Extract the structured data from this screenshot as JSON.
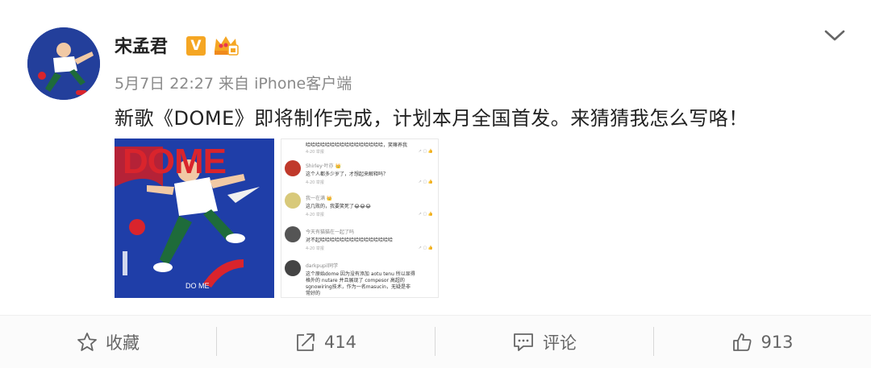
{
  "post": {
    "username": "宋孟君",
    "verified_badge": "V",
    "timestamp": "5月7日 22:27",
    "source": "来自 iPhone客户端",
    "content": "新歌《DOME》即将制作完成，计划本月全国首发。来猜猜我怎么写咯！"
  },
  "images": {
    "album_title": "DOME",
    "album_foot": "DO ME",
    "comments": [
      {
        "name": "",
        "text": "哈哈哈哈哈哈哈哈哈哈哈哈哈哈哈哈，笑嘛养我",
        "foot": "4-20 举报"
      },
      {
        "name": "Shirley·叶亦 👑",
        "text": "这个人都多少岁了，才想起来解释吗？",
        "foot": "4-20 举报"
      },
      {
        "name": "我一在满 👑",
        "text": "这几败的，我要笑死了😂😂😂",
        "foot": "4-20 举报"
      },
      {
        "name": "今天有猫猫在一起了吗",
        "text": "对不起哈哈哈哈哈哈哈哈哈哈哈哈哈哈哈",
        "foot": "4-20 举报"
      },
      {
        "name": "darkpupil同学",
        "text": "这个原始dome 因为没有添加 aotu tenu 所以显得",
        "text2": "格外的 nutare 并且展现了 compesor 高超的",
        "text3": "sgnowiring技术，作为一名masucin，无疑是非",
        "text4": "常好的",
        "foot": ""
      }
    ]
  },
  "actions": {
    "favorite": "收藏",
    "repost": "414",
    "comment": "评论",
    "like": "913"
  },
  "icons": {
    "menu": "chevron-down-icon",
    "favorite": "star-icon",
    "repost": "share-icon",
    "comment": "comment-icon",
    "like": "thumbs-up-icon"
  },
  "colors": {
    "badge": "#f5a623",
    "album_bg": "#1f3ea8",
    "album_title": "#d9242c"
  }
}
